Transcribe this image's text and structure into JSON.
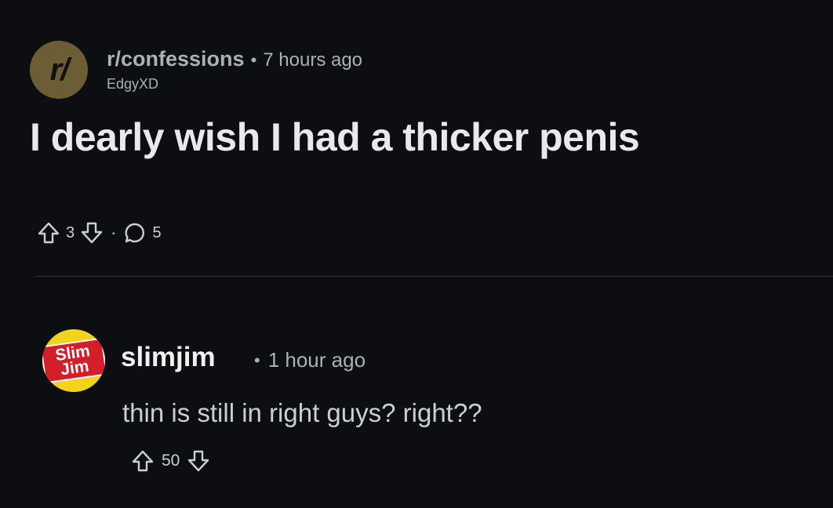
{
  "post": {
    "subreddit": "r/confessions",
    "subreddit_avatar_text": "r/",
    "separator": "•",
    "time": "7 hours ago",
    "author": "EdgyXD",
    "title": "I dearly wish I had a thicker penis",
    "upvotes": "3",
    "comments": "5",
    "action_separator": "·",
    "colors": {
      "avatar_bg": "#6d5d34",
      "background": "#0c0e11"
    }
  },
  "comment": {
    "username": "slimjim",
    "avatar_logo_text": "Slim Jim",
    "separator": "•",
    "time": "1 hour ago",
    "body": "thin is still in right guys? right??",
    "upvotes": "50",
    "colors": {
      "avatar_bg": "#f2d41c",
      "logo_red": "#d21f2a"
    }
  },
  "icons": [
    "upvote-icon",
    "downvote-icon",
    "comment-icon"
  ]
}
